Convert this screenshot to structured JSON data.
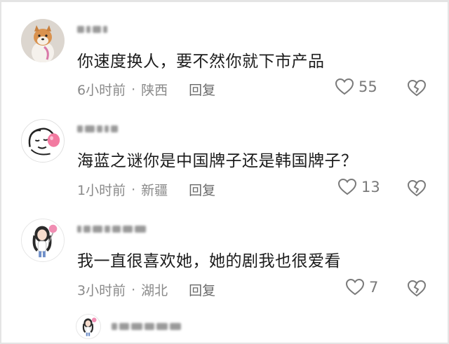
{
  "comments": [
    {
      "text": "你速度换人，要不然你就下市产品",
      "time": "6小时前",
      "location": "陕西",
      "reply_label": "回复",
      "likes": "55"
    },
    {
      "text": "海蓝之谜你是中国牌子还是韩国牌子？",
      "time": "1小时前",
      "location": "新疆",
      "reply_label": "回复",
      "likes": "13"
    },
    {
      "text": "我一直很喜欢她，她的剧我也很爱看",
      "time": "3小时前",
      "location": "湖北",
      "reply_label": "回复",
      "likes": "7"
    }
  ],
  "separator": "·",
  "icons": {
    "like": "heart-outline-icon",
    "dislike": "broken-heart-icon"
  },
  "colors": {
    "text": "#1c1c1c",
    "meta": "#8a8a8a",
    "icon": "#7a7a7a"
  }
}
